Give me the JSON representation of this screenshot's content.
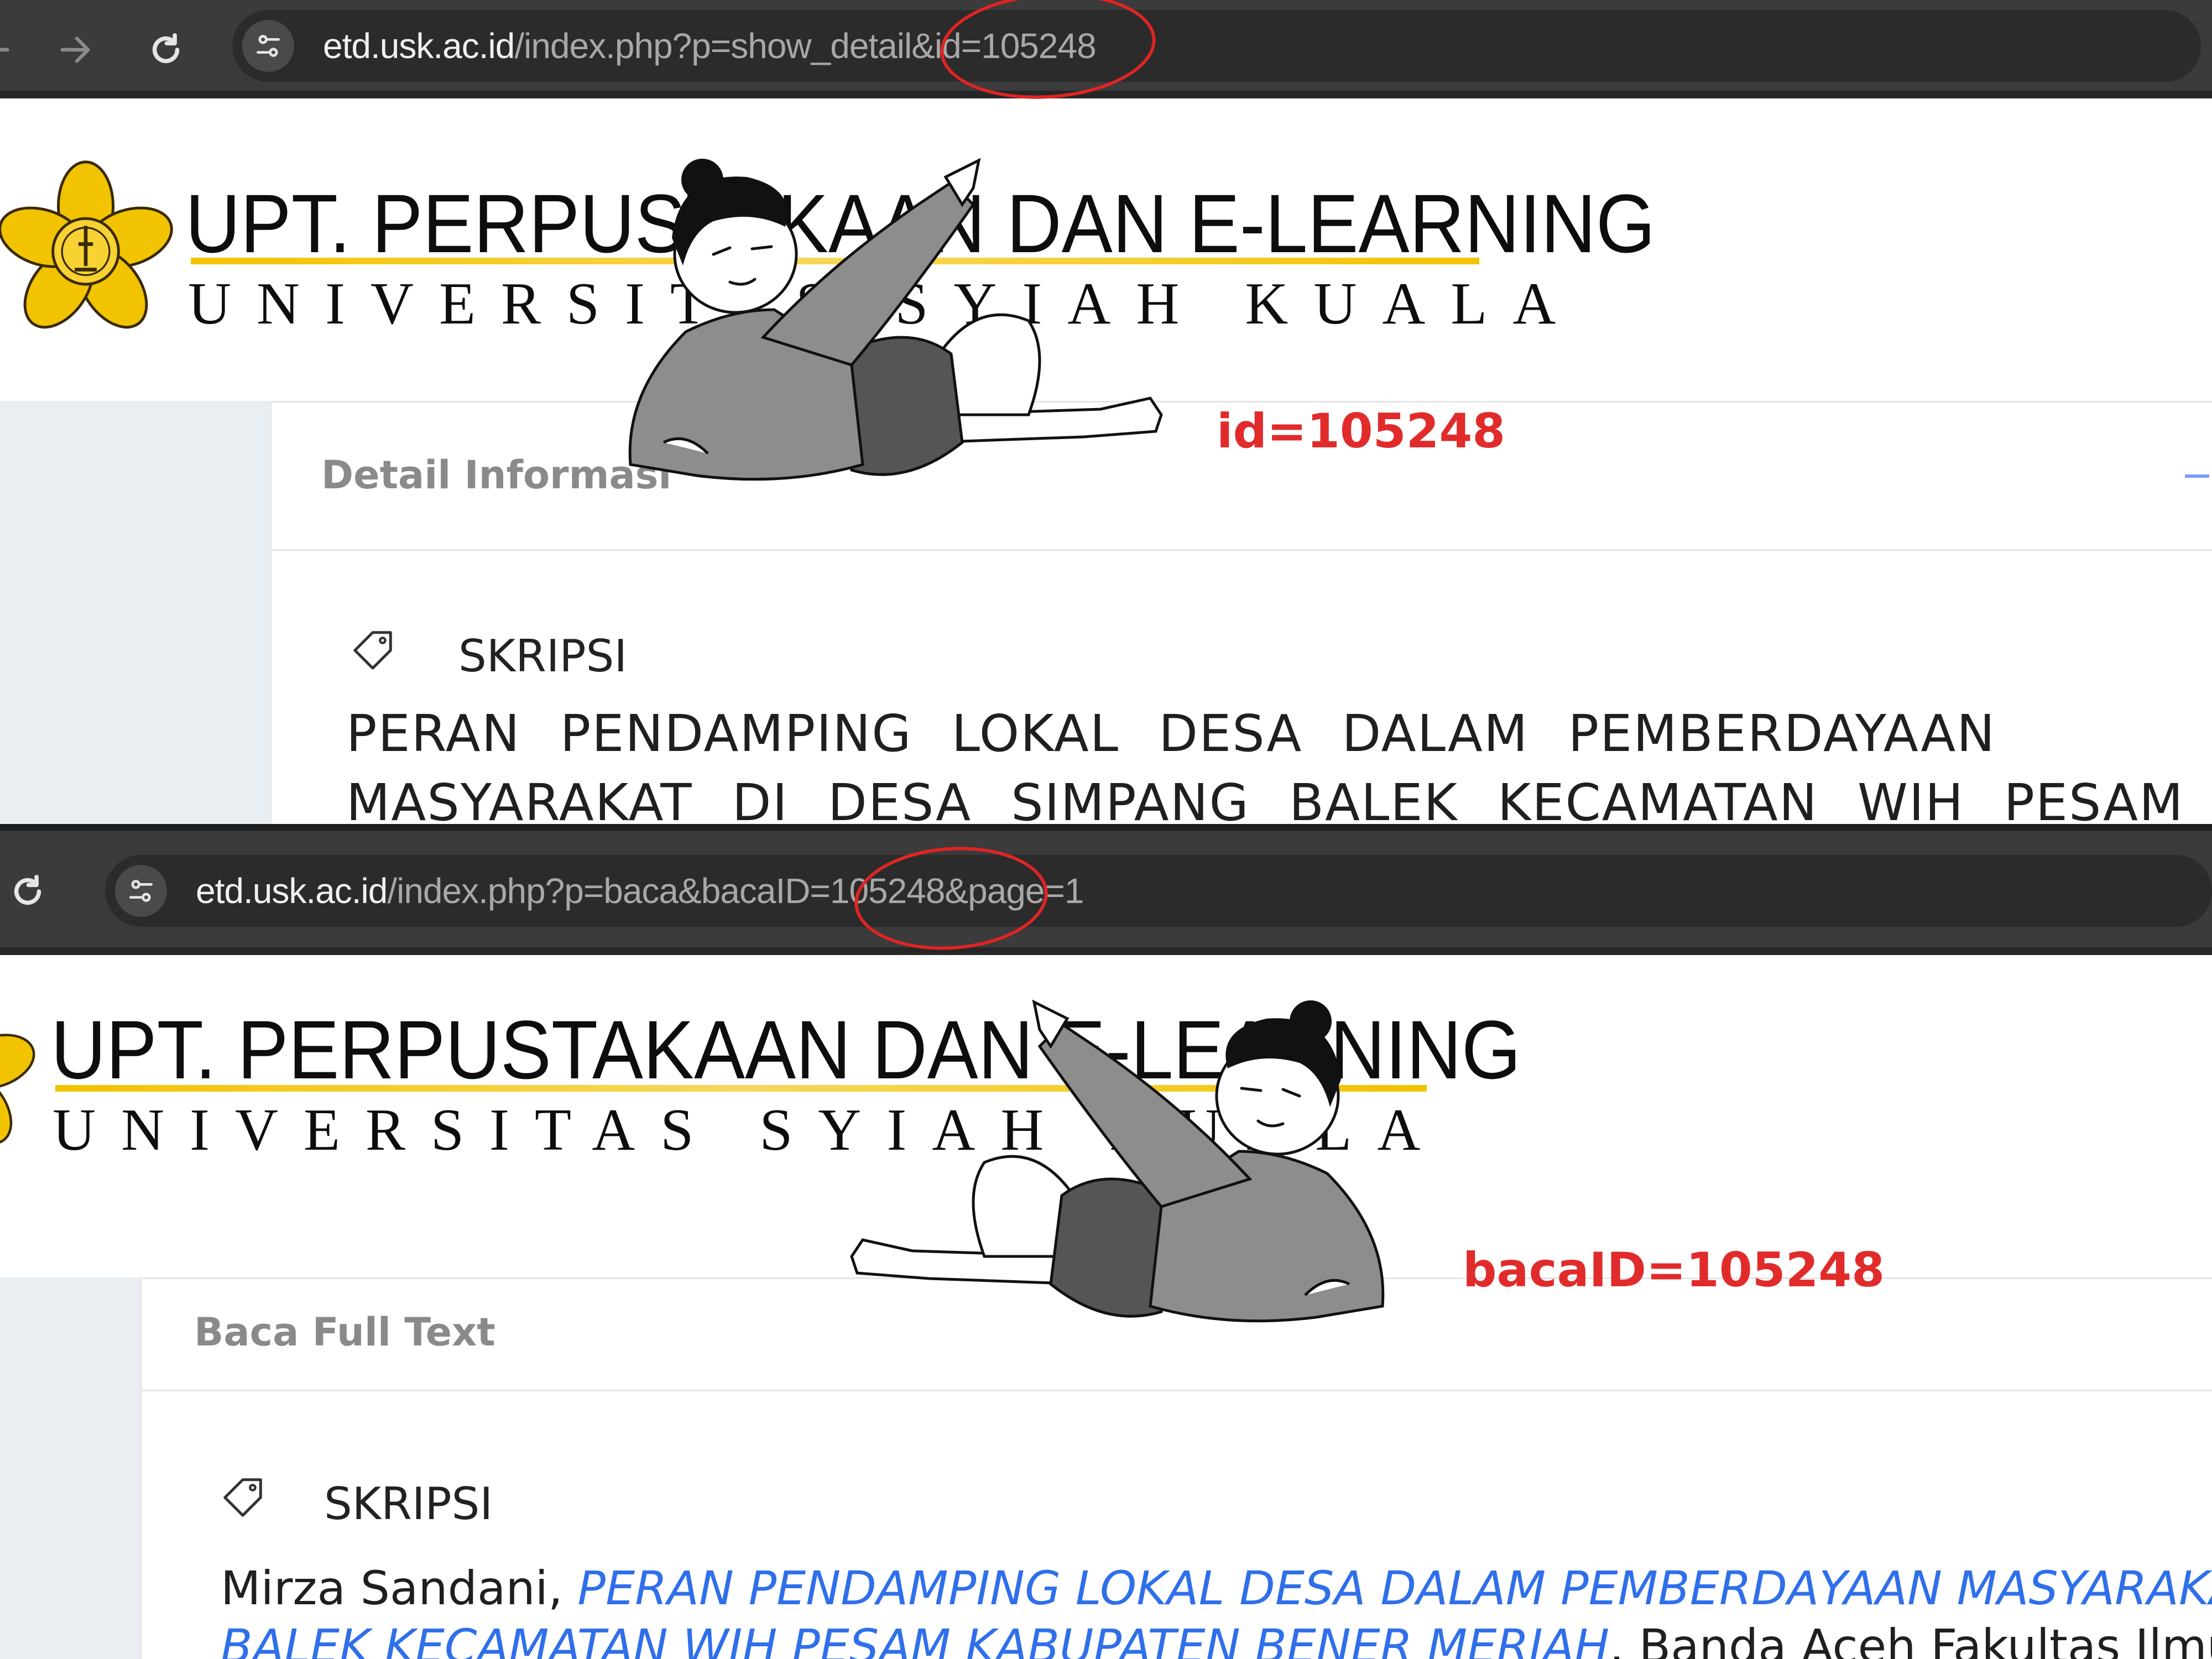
{
  "panel1": {
    "url_host": "etd.usk.ac.id",
    "url_path": "/index.php?p=show_detail&id=105248",
    "logo_title": "UPT. PERPUSTAKAAN DAN E-LEARNING",
    "logo_subtitle": "UNIVERSITAS SYIAH KUALA",
    "card_title": "Detail Informasi",
    "collection_type": "SKRIPSI",
    "thesis_title_line1": "PERAN PENDAMPING LOKAL DESA DALAM PEMBERDAYAAN",
    "thesis_title_line2": "MASYARAKAT DI DESA SIMPANG BALEK KECAMATAN WIH PESAM",
    "annotation": "id=105248"
  },
  "panel2": {
    "url_host": "etd.usk.ac.id",
    "url_path": "/index.php?p=baca&bacaID=105248&page=1",
    "logo_title": "UPT. PERPUSTAKAAN DAN E-LEARNING",
    "logo_subtitle": "UNIVERSITAS SYIAH KUALA",
    "card_title": "Baca Full Text",
    "collection_type": "SKRIPSI",
    "citation_author": "Mirza Sandani, ",
    "citation_title_line1": "PERAN PENDAMPING LOKAL DESA DALAM PEMBERDAYAAN MASYARAKAT DI DESA SIMPANG",
    "citation_title_line2": "BALEK KECAMATAN WIH PESAM KABUPATEN BENER MERIAH",
    "citation_rest": ". Banda Aceh Fakultas Ilmu Sosial Dan Ilmu Politik,",
    "annotation": "bacaID=105248"
  },
  "icons": {
    "back": "arrow-left-icon",
    "forward": "arrow-right-icon",
    "reload": "reload-icon",
    "site_settings": "tune-icon",
    "tag": "tag-icon",
    "logo": "university-flower-logo",
    "illustration": "pointing-person-illustration"
  },
  "colors": {
    "browser_bar": "#3b3b3b",
    "omnibox": "#2b2b2b",
    "annotation_red": "#e02424",
    "logo_gold": "#f2c300",
    "link_blue": "#2f6fea",
    "sidebar_bg": "#e9eef3"
  }
}
